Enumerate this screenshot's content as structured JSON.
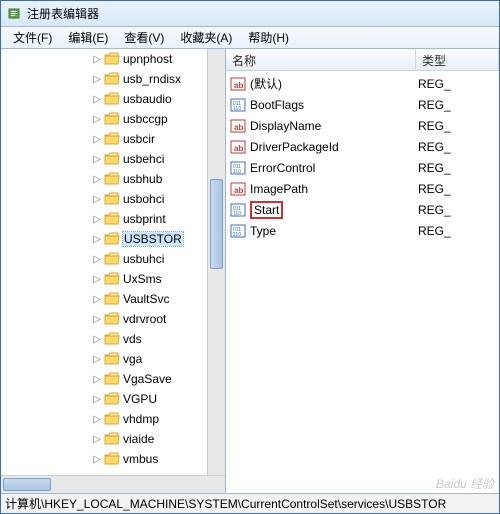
{
  "title": "注册表编辑器",
  "menus": {
    "file": "文件(F)",
    "edit": "编辑(E)",
    "view": "查看(V)",
    "favorites": "收藏夹(A)",
    "help": "帮助(H)"
  },
  "tree": {
    "nodes": [
      {
        "label": "upnphost",
        "selected": false
      },
      {
        "label": "usb_rndisx",
        "selected": false
      },
      {
        "label": "usbaudio",
        "selected": false
      },
      {
        "label": "usbccgp",
        "selected": false
      },
      {
        "label": "usbcir",
        "selected": false
      },
      {
        "label": "usbehci",
        "selected": false
      },
      {
        "label": "usbhub",
        "selected": false
      },
      {
        "label": "usbohci",
        "selected": false
      },
      {
        "label": "usbprint",
        "selected": false
      },
      {
        "label": "USBSTOR",
        "selected": true
      },
      {
        "label": "usbuhci",
        "selected": false
      },
      {
        "label": "UxSms",
        "selected": false
      },
      {
        "label": "VaultSvc",
        "selected": false
      },
      {
        "label": "vdrvroot",
        "selected": false
      },
      {
        "label": "vds",
        "selected": false
      },
      {
        "label": "vga",
        "selected": false
      },
      {
        "label": "VgaSave",
        "selected": false
      },
      {
        "label": "VGPU",
        "selected": false
      },
      {
        "label": "vhdmp",
        "selected": false
      },
      {
        "label": "viaide",
        "selected": false
      },
      {
        "label": "vmbus",
        "selected": false
      }
    ]
  },
  "list": {
    "columns": {
      "name": "名称",
      "type": "类型"
    },
    "rows": [
      {
        "icon": "string",
        "name": "(默认)",
        "type": "REG_",
        "highlight": false
      },
      {
        "icon": "binary",
        "name": "BootFlags",
        "type": "REG_",
        "highlight": false
      },
      {
        "icon": "string",
        "name": "DisplayName",
        "type": "REG_",
        "highlight": false
      },
      {
        "icon": "string",
        "name": "DriverPackageId",
        "type": "REG_",
        "highlight": false
      },
      {
        "icon": "binary",
        "name": "ErrorControl",
        "type": "REG_",
        "highlight": false
      },
      {
        "icon": "string",
        "name": "ImagePath",
        "type": "REG_",
        "highlight": false
      },
      {
        "icon": "binary",
        "name": "Start",
        "type": "REG_",
        "highlight": true
      },
      {
        "icon": "binary",
        "name": "Type",
        "type": "REG_",
        "highlight": false
      }
    ]
  },
  "status_path": "计算机\\HKEY_LOCAL_MACHINE\\SYSTEM\\CurrentControlSet\\services\\USBSTOR",
  "watermark": "Baidu 经验"
}
